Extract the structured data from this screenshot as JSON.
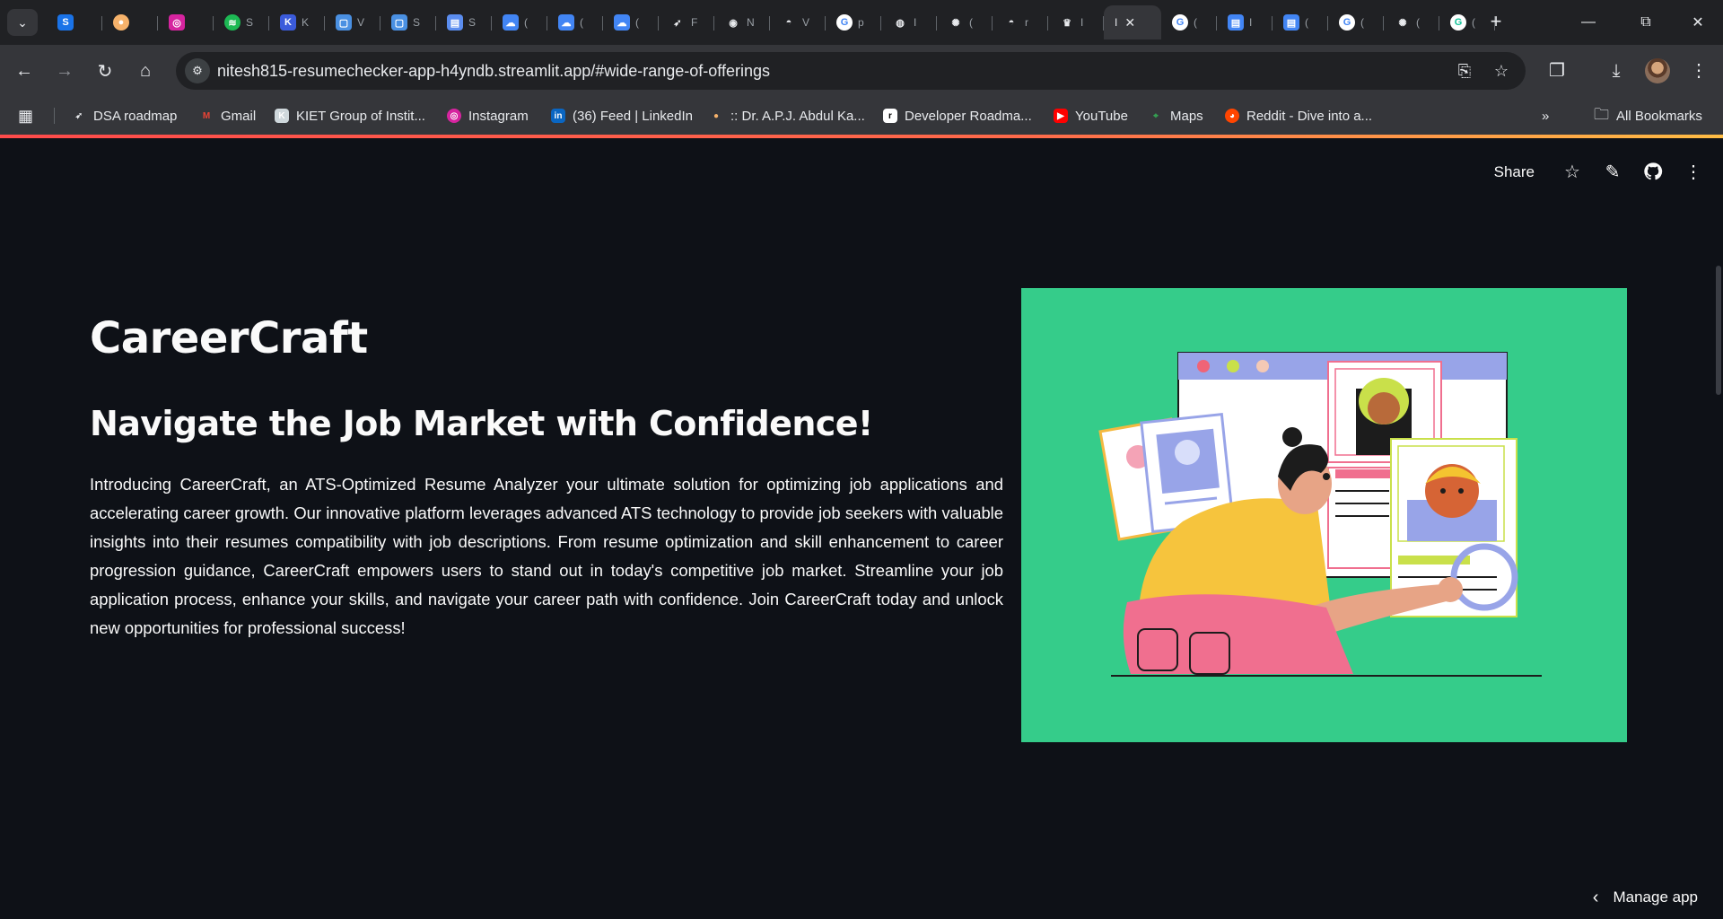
{
  "browser": {
    "tabs": [
      {
        "icon": "tab-search-icon",
        "label": ""
      },
      {
        "icon": "streamlit-s-icon",
        "color": "#1a73e8",
        "label": ""
      },
      {
        "icon": "colorful-circle-icon",
        "color": "#f6b26b",
        "label": ""
      },
      {
        "icon": "instagram-icon",
        "color": "#d6249f",
        "label": ""
      },
      {
        "icon": "spotify-icon",
        "color": "#1db954",
        "label": "S"
      },
      {
        "icon": "kiet-icon",
        "color": "#3b5bdb",
        "label": "K"
      },
      {
        "icon": "square-outline-icon",
        "color": "#4a90e2",
        "label": "V"
      },
      {
        "icon": "square-outline-icon",
        "color": "#4a90e2",
        "label": "S"
      },
      {
        "icon": "doc-icon",
        "color": "#5b8def",
        "label": "S"
      },
      {
        "icon": "google-cloud-icon",
        "color": "#4285f4",
        "label": "("
      },
      {
        "icon": "google-cloud-icon",
        "color": "#4285f4",
        "label": "("
      },
      {
        "icon": "google-cloud-icon",
        "color": "#4285f4",
        "label": "("
      },
      {
        "icon": "rocket-icon",
        "color": "#e8eaed",
        "label": "F"
      },
      {
        "icon": "chromium-icon",
        "color": "#e8eaed",
        "label": "N"
      },
      {
        "icon": "github-icon",
        "color": "#e8eaed",
        "label": "V"
      },
      {
        "icon": "google-icon",
        "color": "#ffffff",
        "label": "p"
      },
      {
        "icon": "globe-icon",
        "color": "#e8eaed",
        "label": "I"
      },
      {
        "icon": "openai-icon",
        "color": "#e8eaed",
        "label": "("
      },
      {
        "icon": "github-icon",
        "color": "#e8eaed",
        "label": "r"
      },
      {
        "icon": "crown-icon",
        "color": "#e8eaed",
        "label": "I"
      },
      {
        "icon": "",
        "color": "",
        "label": "I",
        "active": true
      },
      {
        "icon": "google-icon",
        "color": "#ffffff",
        "label": "("
      },
      {
        "icon": "forms-icon",
        "color": "#4285f4",
        "label": "I"
      },
      {
        "icon": "forms-icon",
        "color": "#4285f4",
        "label": "("
      },
      {
        "icon": "google-icon",
        "color": "#ffffff",
        "label": "("
      },
      {
        "icon": "openai-icon",
        "color": "#e8eaed",
        "label": "("
      },
      {
        "icon": "grammarly-icon",
        "color": "#15c39a",
        "label": "("
      }
    ],
    "url": "nitesh815-resumechecker-app-h4yndb.streamlit.app/#wide-range-of-offerings",
    "bookmarks": [
      {
        "label": "DSA roadmap",
        "icon": "rocket-icon",
        "color": "#e8eaed"
      },
      {
        "label": "Gmail",
        "icon": "gmail-icon",
        "color": "#ea4335"
      },
      {
        "label": "KIET Group of Instit...",
        "icon": "kiet-icon",
        "color": "#cfd8dc"
      },
      {
        "label": "Instagram",
        "icon": "instagram-icon",
        "color": "#d6249f"
      },
      {
        "label": "(36) Feed | LinkedIn",
        "icon": "linkedin-icon",
        "color": "#0a66c2"
      },
      {
        "label": ":: Dr. A.P.J. Abdul Ka...",
        "icon": "colorful-circle-icon",
        "color": "#f6b26b"
      },
      {
        "label": "Developer Roadma...",
        "icon": "roadmap-icon",
        "color": "#ffffff"
      },
      {
        "label": "YouTube",
        "icon": "youtube-icon",
        "color": "#ff0000"
      },
      {
        "label": "Maps",
        "icon": "maps-icon",
        "color": "#34a853"
      },
      {
        "label": "Reddit - Dive into a...",
        "icon": "reddit-icon",
        "color": "#ff4500"
      }
    ],
    "all_bookmarks_label": "All Bookmarks"
  },
  "app": {
    "header": {
      "share_label": "Share"
    },
    "title": "CareerCraft",
    "subtitle": "Navigate the Job Market with Confidence!",
    "description": "Introducing CareerCraft, an ATS-Optimized Resume Analyzer your ultimate solution for optimizing job applications and accelerating career growth. Our innovative platform leverages advanced ATS technology to provide job seekers with valuable insights into their resumes compatibility with job descriptions. From resume optimization and skill enhancement to career progression guidance, CareerCraft empowers users to stand out in today's competitive job market. Streamline your job application process, enhance your skills, and navigate your career path with confidence. Join CareerCraft today and unlock new opportunities for professional success!",
    "hero_background": "#35cc8a",
    "manage_app_label": "Manage app"
  }
}
